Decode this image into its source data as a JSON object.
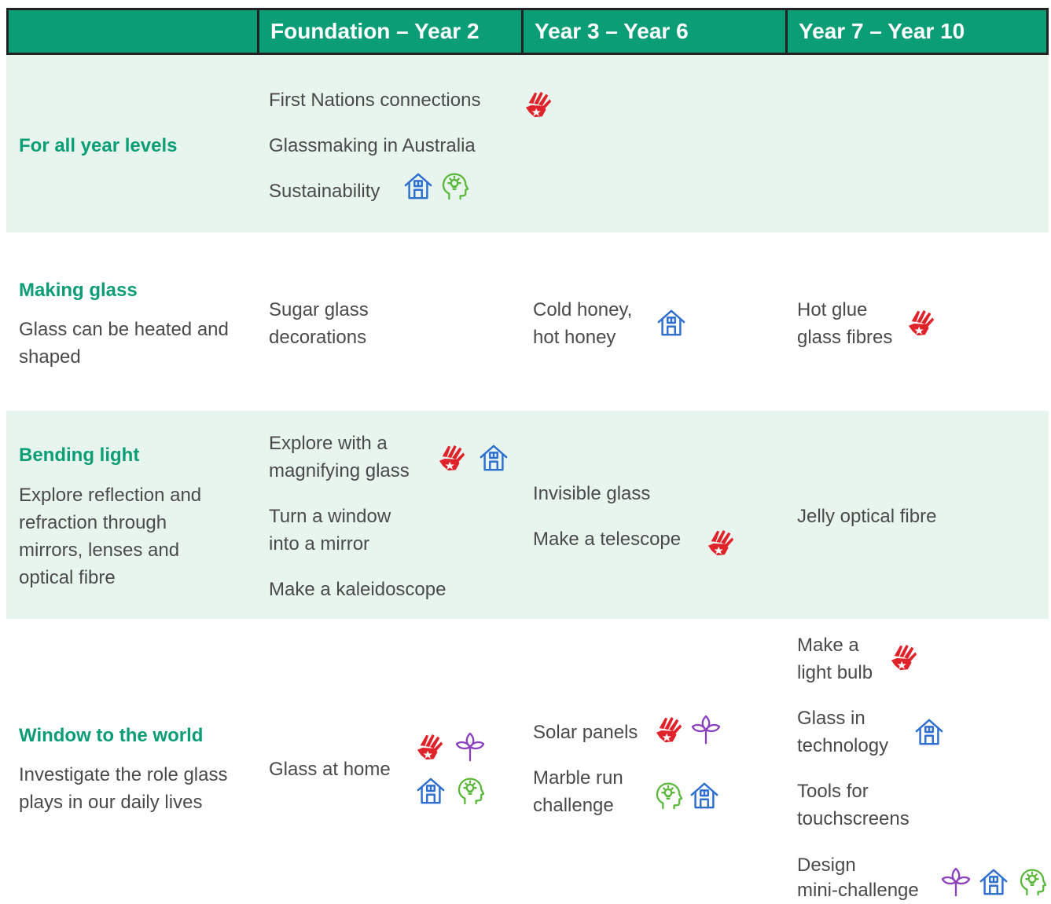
{
  "header": {
    "col1": "Foundation – Year 2",
    "col2": "Year 3 – Year 6",
    "col3": "Year 7 – Year 10"
  },
  "rows": {
    "all": {
      "title": "For all year levels",
      "items": [
        "First Nations connections",
        "Glassmaking in Australia",
        "Sustainability"
      ]
    },
    "making": {
      "title": "Making glass",
      "desc": [
        "Glass can be heated and",
        "shaped"
      ],
      "f2": [
        "Sugar glass",
        "decorations"
      ],
      "y36": [
        "Cold honey,",
        "hot honey"
      ],
      "y710": [
        "Hot glue",
        "glass fibres"
      ]
    },
    "bending": {
      "title": "Bending light",
      "desc": [
        "Explore reflection and",
        "refraction through",
        "mirrors, lenses and",
        "optical fibre"
      ],
      "f2": [
        "Explore with a",
        "magnifying glass",
        "Turn a window",
        "into a mirror",
        "Make a kaleidoscope"
      ],
      "y36": [
        "Invisible glass",
        "Make a telescope"
      ],
      "y710": [
        "Jelly optical fibre"
      ]
    },
    "window": {
      "title": "Window to the world",
      "desc": [
        "Investigate the role glass",
        "plays in our daily lives"
      ],
      "f2": [
        "Glass at home"
      ],
      "y36": [
        "Solar panels",
        "Marble run",
        "challenge"
      ],
      "y710": [
        "Make a",
        "light bulb",
        "Glass in",
        "technology",
        "Tools for",
        "touchscreens",
        "Design",
        "mini-challenge"
      ]
    }
  },
  "colors": {
    "header_bg": "#0b9e76",
    "band_bg": "#e7f5ee",
    "title_green": "#0b9e76",
    "hand_red": "#e0232b",
    "house_blue": "#2f6fd0",
    "head_green": "#59b83a",
    "leaf_purple": "#8a3ec0"
  },
  "icons": [
    "hand-icon",
    "house-icon",
    "head-bulb-icon",
    "leaf-icon"
  ]
}
